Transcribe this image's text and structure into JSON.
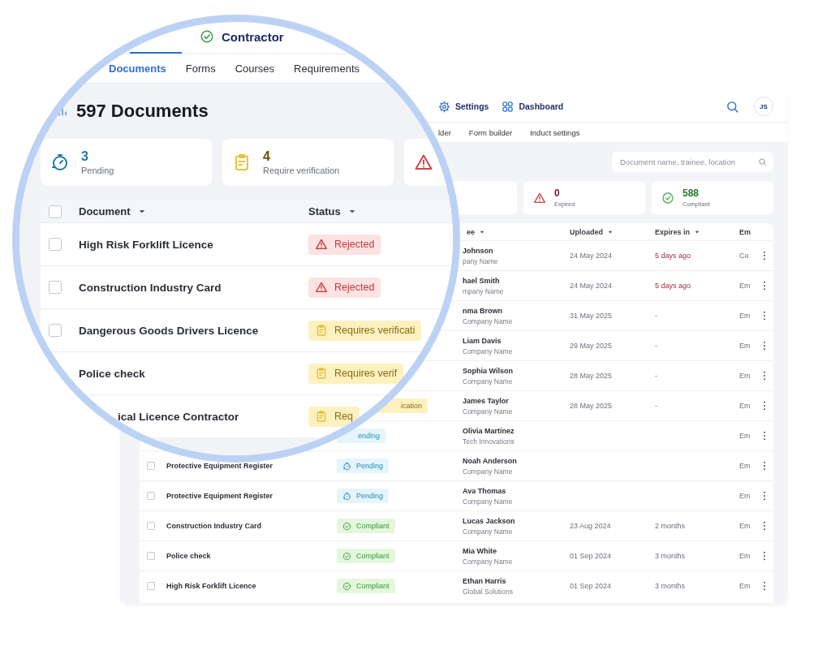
{
  "app": {
    "nav": [
      {
        "kind": "settings",
        "label": "Settings"
      },
      {
        "kind": "dashboard",
        "label": "Dashboard"
      }
    ],
    "avatar": "JS",
    "subnav": [
      "lder",
      "Form builder",
      "Induct settings"
    ],
    "search": {
      "placeholder": "Document name, trainee, location"
    },
    "stats": [
      {
        "kind": "blank"
      },
      {
        "kind": "expired",
        "value": "0",
        "label": "Expired"
      },
      {
        "kind": "compliant",
        "value": "588",
        "label": "Compliant"
      }
    ],
    "columns": [
      {
        "label": "ee",
        "sortable": true
      },
      {
        "label": "Uploaded",
        "sortable": true
      },
      {
        "label": "Expires in",
        "sortable": true
      },
      {
        "label": "Em"
      }
    ],
    "rows": [
      {
        "trainee": "Johnson",
        "company": "pany Name",
        "uploaded": "24 May 2024",
        "expires": "5 days ago",
        "overdue": true,
        "column_4": "Co"
      },
      {
        "trainee": "hael Smith",
        "company": "mpany Name",
        "uploaded": "24 May 2024",
        "expires": "5 days ago",
        "overdue": true,
        "column_4": "Em"
      },
      {
        "trainee": "nma Brown",
        "company": "Company Name",
        "uploaded": "31 May 2025",
        "expires": "-",
        "overdue": false,
        "column_4": "Em"
      },
      {
        "trainee": "Liam Davis",
        "company": "Company Name",
        "uploaded": "29 May 2025",
        "expires": "-",
        "overdue": false,
        "column_4": "Em"
      },
      {
        "trainee": "Sophia Wilson",
        "company": "Company Name",
        "uploaded": "28 May 2025",
        "expires": "-",
        "overdue": false,
        "column_4": "Em"
      },
      {
        "status_cut": {
          "kind": "verification",
          "text": "ication"
        },
        "trainee": "James Taylor",
        "company": "Company Name",
        "uploaded": "28 May 2025",
        "expires": "-",
        "overdue": false,
        "column_4": "Em"
      },
      {
        "status_cut": {
          "kind": "pending",
          "text": "ending"
        },
        "trainee": "Olivia Martinez",
        "company": "Tech Innovations",
        "column_4": "Em"
      },
      {
        "checked": false,
        "document": "Protective Equipment Register",
        "status": {
          "kind": "pending",
          "text": "Pending"
        },
        "trainee": "Noah Anderson",
        "company": "Company Name",
        "column_4": "Em"
      },
      {
        "checked": false,
        "document": "Protective Equipment Register",
        "status": {
          "kind": "pending",
          "text": "Pending"
        },
        "trainee": "Ava Thomas",
        "company": "Company Name",
        "column_4": "Em"
      },
      {
        "checked": false,
        "document": "Construction Industry Card",
        "status": {
          "kind": "compliant",
          "text": "Compliant"
        },
        "trainee": "Lucas Jackson",
        "company": "Company Name",
        "uploaded": "23 Aug 2024",
        "expires": "2 months",
        "overdue": false,
        "column_4": "Em"
      },
      {
        "checked": false,
        "document": "Police check",
        "status": {
          "kind": "compliant",
          "text": "Compliant"
        },
        "trainee": "Mia White",
        "company": "Company Name",
        "uploaded": "01 Sep 2024",
        "expires": "3 months",
        "overdue": false,
        "column_4": "Em"
      },
      {
        "checked": false,
        "document": "High Risk Forklift Licence",
        "status": {
          "kind": "compliant",
          "text": "Compliant"
        },
        "trainee": "Ethan Harris",
        "company": "Global Solutions",
        "uploaded": "01 Sep 2024",
        "expires": "3 months",
        "overdue": false,
        "column_4": "Em"
      }
    ]
  },
  "magnifier": {
    "tabs": [
      {
        "kind": "text",
        "selected": true
      },
      {
        "kind": "check",
        "label": "Contractor",
        "selected": false
      }
    ],
    "subtabs": [
      {
        "label": "Documents",
        "selected": true
      },
      {
        "label": "Forms",
        "selected": false
      },
      {
        "label": "Courses",
        "selected": false
      },
      {
        "label": "Requirements",
        "selected": false
      }
    ],
    "title": "597 Documents",
    "stats": [
      {
        "kind": "pending",
        "value": "3",
        "label": "Pending"
      },
      {
        "kind": "verification",
        "value": "4",
        "label": "Require verification"
      },
      {
        "kind": "rejected"
      }
    ],
    "select_all": {
      "checked": false
    },
    "columns": [
      {
        "label": "Document",
        "sortable": true
      },
      {
        "label": "Status",
        "sortable": true
      }
    ],
    "rows": [
      {
        "checked": false,
        "document": "High Risk Forklift Licence",
        "status": {
          "kind": "rejected",
          "text": "Rejected"
        }
      },
      {
        "checked": false,
        "document": "Construction Industry Card",
        "status": {
          "kind": "rejected",
          "text": "Rejected"
        }
      },
      {
        "checked": false,
        "document": "Dangerous Goods Drivers Licence",
        "status": {
          "kind": "verification",
          "text": "Requires verificati"
        }
      },
      {
        "document": "Police check",
        "status": {
          "kind": "verification",
          "text": "Requires verif"
        }
      },
      {
        "document": "ical Licence Contractor",
        "status": {
          "kind": "verification",
          "text": "Req"
        }
      }
    ]
  }
}
